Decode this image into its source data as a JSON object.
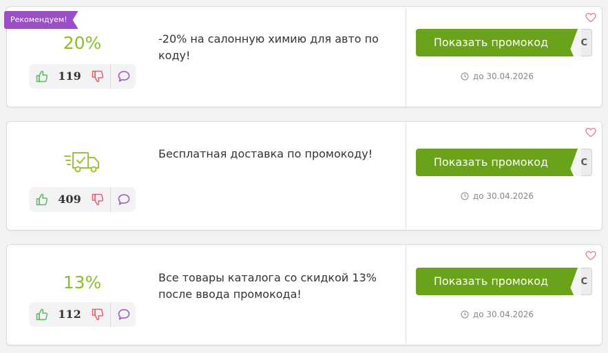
{
  "coupons": [
    {
      "badge": "Рекомендуем!",
      "discount": "20%",
      "votes": "119",
      "description": "-20% на салонную химию для авто по коду!",
      "button_label": "Показать промокод",
      "code_peek": "C",
      "expiry": "до 30.04.2026"
    },
    {
      "icon": "delivery-truck-icon",
      "votes": "409",
      "description": "Бесплатная доставка по промокоду!",
      "button_label": "Показать промокод",
      "code_peek": "C",
      "expiry": "до 30.04.2026"
    },
    {
      "discount": "13%",
      "votes": "112",
      "description": "Все товары каталога со скидкой 13% после ввода промокода!",
      "button_label": "Показать промокод",
      "code_peek": "C",
      "expiry": "до 30.04.2026"
    }
  ],
  "colors": {
    "accent_green": "#6aa31a",
    "discount_green": "#8cbf26",
    "badge_purple": "#9b4fc4",
    "like_green": "#5cb85c",
    "dislike_red": "#e06070",
    "comment_purple": "#9b4fc4"
  }
}
